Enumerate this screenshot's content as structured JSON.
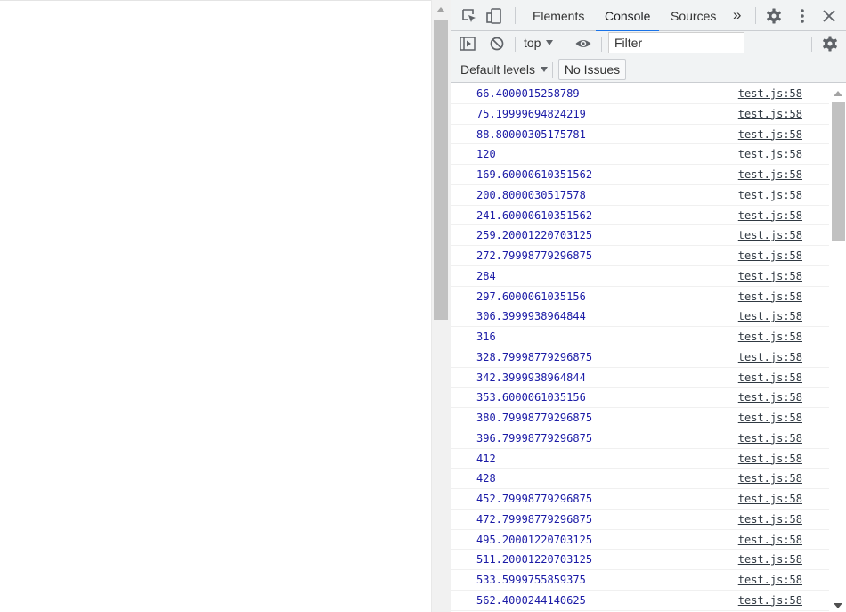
{
  "devtools": {
    "tabs": [
      {
        "label": "Elements",
        "active": false
      },
      {
        "label": "Console",
        "active": true
      },
      {
        "label": "Sources",
        "active": false
      }
    ],
    "more_tabs_glyph": "»",
    "icons": [
      "inspect-element-icon",
      "device-toolbar-icon",
      "more-tabs-icon",
      "settings-gear-icon",
      "kebab-menu-icon",
      "close-icon"
    ],
    "accent_color": "#1a73e8"
  },
  "console_toolbar": {
    "context": "top",
    "filter_placeholder": "Filter",
    "levels": "Default levels",
    "issues": "No Issues"
  },
  "console": {
    "value_color": "#1a1aa6",
    "messages": [
      {
        "value": "66.4000015258789",
        "source": "test.js:58"
      },
      {
        "value": "75.19999694824219",
        "source": "test.js:58"
      },
      {
        "value": "88.80000305175781",
        "source": "test.js:58"
      },
      {
        "value": "120",
        "source": "test.js:58"
      },
      {
        "value": "169.60000610351562",
        "source": "test.js:58"
      },
      {
        "value": "200.8000030517578",
        "source": "test.js:58"
      },
      {
        "value": "241.60000610351562",
        "source": "test.js:58"
      },
      {
        "value": "259.20001220703125",
        "source": "test.js:58"
      },
      {
        "value": "272.79998779296875",
        "source": "test.js:58"
      },
      {
        "value": "284",
        "source": "test.js:58"
      },
      {
        "value": "297.6000061035156",
        "source": "test.js:58"
      },
      {
        "value": "306.3999938964844",
        "source": "test.js:58"
      },
      {
        "value": "316",
        "source": "test.js:58"
      },
      {
        "value": "328.79998779296875",
        "source": "test.js:58"
      },
      {
        "value": "342.3999938964844",
        "source": "test.js:58"
      },
      {
        "value": "353.6000061035156",
        "source": "test.js:58"
      },
      {
        "value": "380.79998779296875",
        "source": "test.js:58"
      },
      {
        "value": "396.79998779296875",
        "source": "test.js:58"
      },
      {
        "value": "412",
        "source": "test.js:58"
      },
      {
        "value": "428",
        "source": "test.js:58"
      },
      {
        "value": "452.79998779296875",
        "source": "test.js:58"
      },
      {
        "value": "472.79998779296875",
        "source": "test.js:58"
      },
      {
        "value": "495.20001220703125",
        "source": "test.js:58"
      },
      {
        "value": "511.20001220703125",
        "source": "test.js:58"
      },
      {
        "value": "533.5999755859375",
        "source": "test.js:58"
      },
      {
        "value": "562.4000244140625",
        "source": "test.js:58"
      }
    ]
  }
}
